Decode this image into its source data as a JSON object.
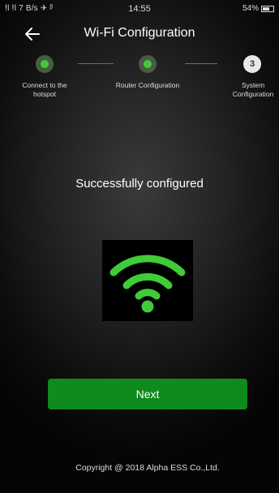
{
  "status_bar": {
    "signal": "ⵑl ⵑl 7 B/s ✈ ᵝ",
    "time": "14:55",
    "battery_text": "54%",
    "battery_level": 0.54
  },
  "header": {
    "title": "Wi-Fi Configuration"
  },
  "steps": [
    {
      "label": "Connect to the hotspot",
      "state": "done"
    },
    {
      "label": "Router Configuration",
      "state": "done"
    },
    {
      "label": "System Configuration",
      "state": "current",
      "number": "3"
    }
  ],
  "main": {
    "message": "Successfully configured",
    "icon": "wifi-icon"
  },
  "actions": {
    "next_label": "Next"
  },
  "footer": {
    "copyright": "Copyright @ 2018 Alpha ESS Co.,Ltd."
  },
  "colors": {
    "accent": "#3fcc38",
    "button": "#0f8a1c",
    "step_done_ring": "#4a5b44"
  }
}
